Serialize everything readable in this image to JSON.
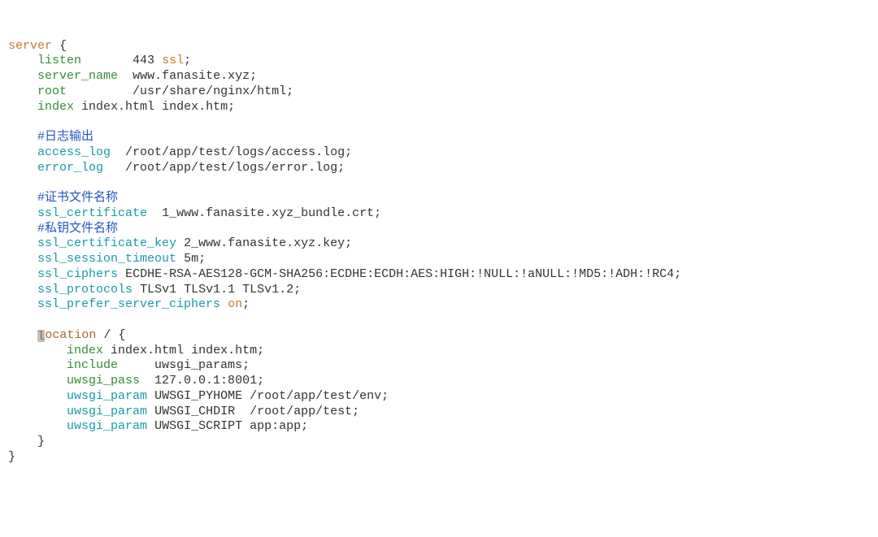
{
  "tokens": {
    "server": "server",
    "brace_open": "{",
    "brace_close": "}",
    "listen": "listen",
    "listen_val": "443",
    "ssl": "ssl",
    "semicolon": ";",
    "server_name": "server_name",
    "server_name_val": "www.fanasite.xyz",
    "root": "root",
    "root_val": "/usr/share/nginx/html",
    "index": "index",
    "index_vals": "index.html index.htm",
    "comment_log": "#日志输出",
    "access_log": "access_log",
    "access_log_val": "/root/app/test/logs/access.log",
    "error_log": "error_log",
    "error_log_val": "/root/app/test/logs/error.log",
    "comment_cert": "#证书文件名称",
    "ssl_certificate": "ssl_certificate",
    "ssl_certificate_val": "1_www.fanasite.xyz_bundle.crt",
    "comment_key": "#私钥文件名称",
    "ssl_certificate_key": "ssl_certificate_key",
    "ssl_certificate_key_val": "2_www.fanasite.xyz.key",
    "ssl_session_timeout": "ssl_session_timeout",
    "ssl_session_timeout_val": "5m",
    "ssl_ciphers": "ssl_ciphers",
    "ssl_ciphers_val": "ECDHE-RSA-AES128-GCM-SHA256:ECDHE:ECDH:AES:HIGH:!NULL:!aNULL:!MD5:!ADH:!RC4",
    "ssl_protocols": "ssl_protocols",
    "ssl_protocols_val": "TLSv1 TLSv1.1 TLSv1.2",
    "ssl_prefer_server_ciphers": "ssl_prefer_server_ciphers",
    "on": "on",
    "location": "ocation",
    "location_first": "l",
    "slash": "/",
    "include": "include",
    "include_val": "uwsgi_params",
    "uwsgi_pass": "uwsgi_pass",
    "uwsgi_pass_val": "127.0.0.1:8001",
    "uwsgi_param": "uwsgi_param",
    "uwsgi_pyhome": "UWSGI_PYHOME /root/app/test/env",
    "uwsgi_chdir": "UWSGI_CHDIR  /root/app/test",
    "uwsgi_script": "UWSGI_SCRIPT app:app"
  }
}
